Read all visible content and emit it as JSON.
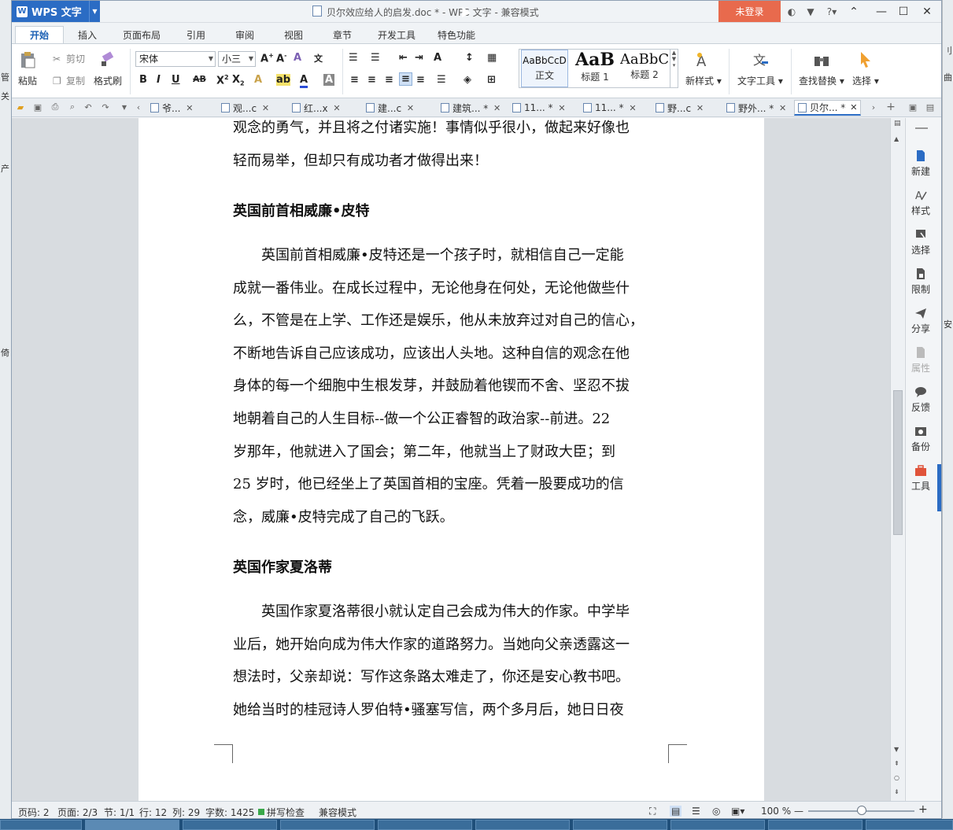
{
  "app": {
    "badge": "WPS 文字",
    "title": "贝尔效应给人的启发.doc * - WPS 文字 - 兼容模式",
    "login": "未登录",
    "help": "?"
  },
  "ribbon_tabs": [
    "开始",
    "插入",
    "页面布局",
    "引用",
    "审阅",
    "视图",
    "章节",
    "开发工具",
    "特色功能"
  ],
  "ribbon": {
    "paste": "粘贴",
    "cut": "剪切",
    "copy": "复制",
    "format_painter": "格式刷",
    "font_name": "宋体",
    "font_size": "小三",
    "styles": [
      {
        "preview": "AaBbCcD",
        "label": "正文"
      },
      {
        "preview": "AaB",
        "label": "标题 1"
      },
      {
        "preview": "AaBbC",
        "label": "标题 2"
      }
    ],
    "new_style": "新样式",
    "text_tools": "文字工具",
    "find_replace": "查找替换",
    "select": "选择"
  },
  "doc_tabs": [
    "爷...",
    "观...c",
    "红...x",
    "建...c",
    "建筑... *",
    "11... *",
    "11... *",
    "野...c",
    "野外... *",
    "贝尔... *"
  ],
  "document": {
    "top_lines": [
      "观念的勇气，并且将之付诸实施！事情似乎很小，做起来好像也",
      "轻而易举，但却只有成功者才做得出来！"
    ],
    "heading1": "英国前首相威廉•皮特",
    "para1": [
      "英国前首相威廉•皮特还是一个孩子时，就相信自己一定能",
      "成就一番伟业。在成长过程中，无论他身在何处，无论他做些什",
      "么，不管是在上学、工作还是娱乐，他从未放弃过对自己的信心，",
      "不断地告诉自己应该成功，应该出人头地。这种自信的观念在他",
      "身体的每一个细胞中生根发芽，并鼓励着他锲而不舍、坚忍不拔",
      "地朝着自己的人生目标--做一个公正睿智的政治家--前进。22",
      "岁那年，他就进入了国会；第二年，他就当上了财政大臣；到",
      "25 岁时，他已经坐上了英国首相的宝座。凭着一股要成功的信",
      "念，威廉•皮特完成了自己的飞跃。"
    ],
    "heading2": "英国作家夏洛蒂",
    "para2": [
      "英国作家夏洛蒂很小就认定自己会成为伟大的作家。中学毕",
      "业后，她开始向成为伟大作家的道路努力。当她向父亲透露这一",
      "想法时，父亲却说：写作这条路太难走了，你还是安心教书吧。",
      "她给当时的桂冠诗人罗伯特•骚塞写信，两个多月后，她日日夜"
    ]
  },
  "sidebar": [
    {
      "label": "新建",
      "icon": "new-doc-icon"
    },
    {
      "label": "样式",
      "icon": "style-icon"
    },
    {
      "label": "选择",
      "icon": "select-icon"
    },
    {
      "label": "限制",
      "icon": "restrict-icon"
    },
    {
      "label": "分享",
      "icon": "share-icon"
    },
    {
      "label": "属性",
      "icon": "properties-icon"
    },
    {
      "label": "反馈",
      "icon": "feedback-icon"
    },
    {
      "label": "备份",
      "icon": "backup-icon"
    },
    {
      "label": "工具",
      "icon": "toolbox-icon"
    }
  ],
  "status": {
    "page_code": "页码: 2",
    "pages": "页面: 2/3",
    "section": "节: 1/1",
    "row": "行: 12",
    "col": "列: 29",
    "words": "字数: 1425",
    "spell": "拼写检查",
    "compat": "兼容模式",
    "zoom": "100 %"
  },
  "colors": {
    "accent": "#2b6cc4",
    "login": "#e86a4d"
  }
}
